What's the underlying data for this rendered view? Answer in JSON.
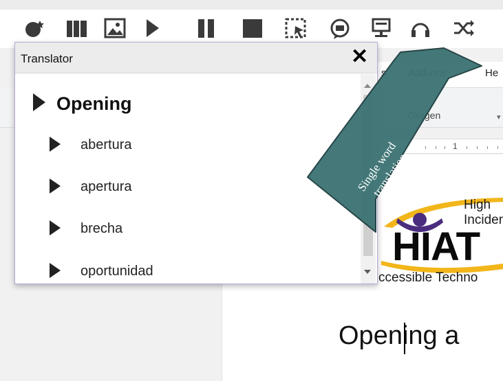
{
  "toolbar": {
    "icons": [
      "wand-icon",
      "library-icon",
      "picture-icon",
      "play-icon",
      "pause-icon",
      "stop-icon",
      "screen-select-icon",
      "speech-bubble-icon",
      "monitor-icon",
      "headphones-icon",
      "shuffle-icon"
    ]
  },
  "docs": {
    "menu_partial": "s",
    "menu_addons": "Add-ons",
    "menu_help_partial": "He",
    "font_name": "Oxygen",
    "font_arrow": "▾",
    "ruler_number": "1",
    "heading": "Opening a"
  },
  "logo": {
    "line1": "High",
    "line2": "Incidenc",
    "main": "HIAT",
    "tagline": "ccessible Techno"
  },
  "translator": {
    "title": "Translator",
    "close_label": "✕",
    "main_word": "Opening",
    "translations": [
      "abertura",
      "apertura",
      "brecha",
      "oportunidad"
    ]
  },
  "callout": {
    "line1": "Single word",
    "line2": "translation",
    "color": "#3d7374"
  }
}
